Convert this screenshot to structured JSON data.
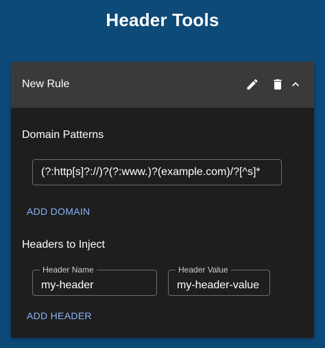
{
  "app": {
    "title": "Header Tools"
  },
  "rule": {
    "title": "New Rule",
    "icons": {
      "edit": "pencil-icon",
      "delete": "trash-icon",
      "collapse": "chevron-up-icon"
    }
  },
  "domains": {
    "label": "Domain Patterns",
    "patterns": [
      {
        "value": "(?:http[s]?://)?(?:www.)?(example.com)/?[^s]*"
      }
    ],
    "add_label": "ADD DOMAIN"
  },
  "headers": {
    "label": "Headers to Inject",
    "name_label": "Header Name",
    "value_label": "Header Value",
    "items": [
      {
        "name": "my-header",
        "value": "my-header-value"
      }
    ],
    "add_label": "ADD HEADER"
  },
  "colors": {
    "background": "#0d4a78",
    "card": "#1e1e1e",
    "card_header": "#3a3a3a",
    "accent": "#8ab4f8"
  }
}
